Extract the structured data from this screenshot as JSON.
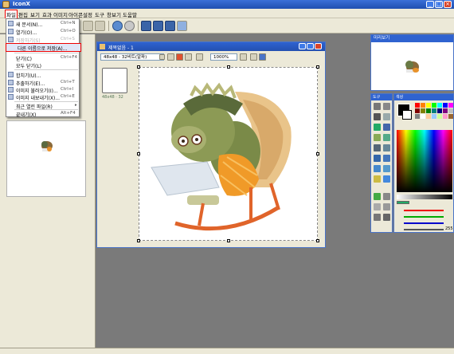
{
  "window": {
    "title": "IconX"
  },
  "menubar": {
    "items": [
      "파일",
      "편집",
      "보기",
      "효과",
      "이미지",
      "아이콘",
      "설정",
      "도구",
      "창보기",
      "도움말"
    ]
  },
  "file_menu": {
    "items": [
      {
        "label": "새 문서(N)...",
        "shortcut": "Ctrl+N",
        "disabled": false
      },
      {
        "label": "열기(O)...",
        "shortcut": "Ctrl+O",
        "disabled": false
      },
      {
        "label": "저장하기(S)",
        "shortcut": "Ctrl+S",
        "disabled": true
      },
      {
        "label": "다른 이름으로 저장(A)...",
        "shortcut": "",
        "disabled": false,
        "highlighted": true
      },
      {
        "label": "닫기(C)",
        "shortcut": "Ctrl+F4",
        "disabled": false
      },
      {
        "label": "모두 닫기(L)",
        "shortcut": "",
        "disabled": false
      },
      {
        "label": "합치기(U)...",
        "shortcut": "",
        "disabled": false
      },
      {
        "label": "추출하기(E)...",
        "shortcut": "Ctrl+T",
        "disabled": false
      },
      {
        "label": "이미지 불러오기(I)...",
        "shortcut": "Ctrl+I",
        "disabled": false
      },
      {
        "label": "이미지 내보내기(X)...",
        "shortcut": "Ctrl+E",
        "disabled": false
      },
      {
        "label": "최근 열린 파일(R)",
        "shortcut": "▸",
        "disabled": false
      },
      {
        "label": "끝내기(X)",
        "shortcut": "Alt+F4",
        "disabled": false
      }
    ]
  },
  "image_window": {
    "title": "제목없음 - 1",
    "format_select": "48x48 - 32비트(알파)",
    "zoom": "1000%",
    "thumb_caption": "48x48 · 32"
  },
  "navigator": {
    "title": "미리보기"
  },
  "tools": {
    "title": "도구"
  },
  "colors": {
    "title": "색상",
    "alpha_value": "255"
  },
  "colors_hex": {
    "accent_red": "#e00000",
    "titlebar": "#2f63d0",
    "bg": "#7a7a7a"
  }
}
